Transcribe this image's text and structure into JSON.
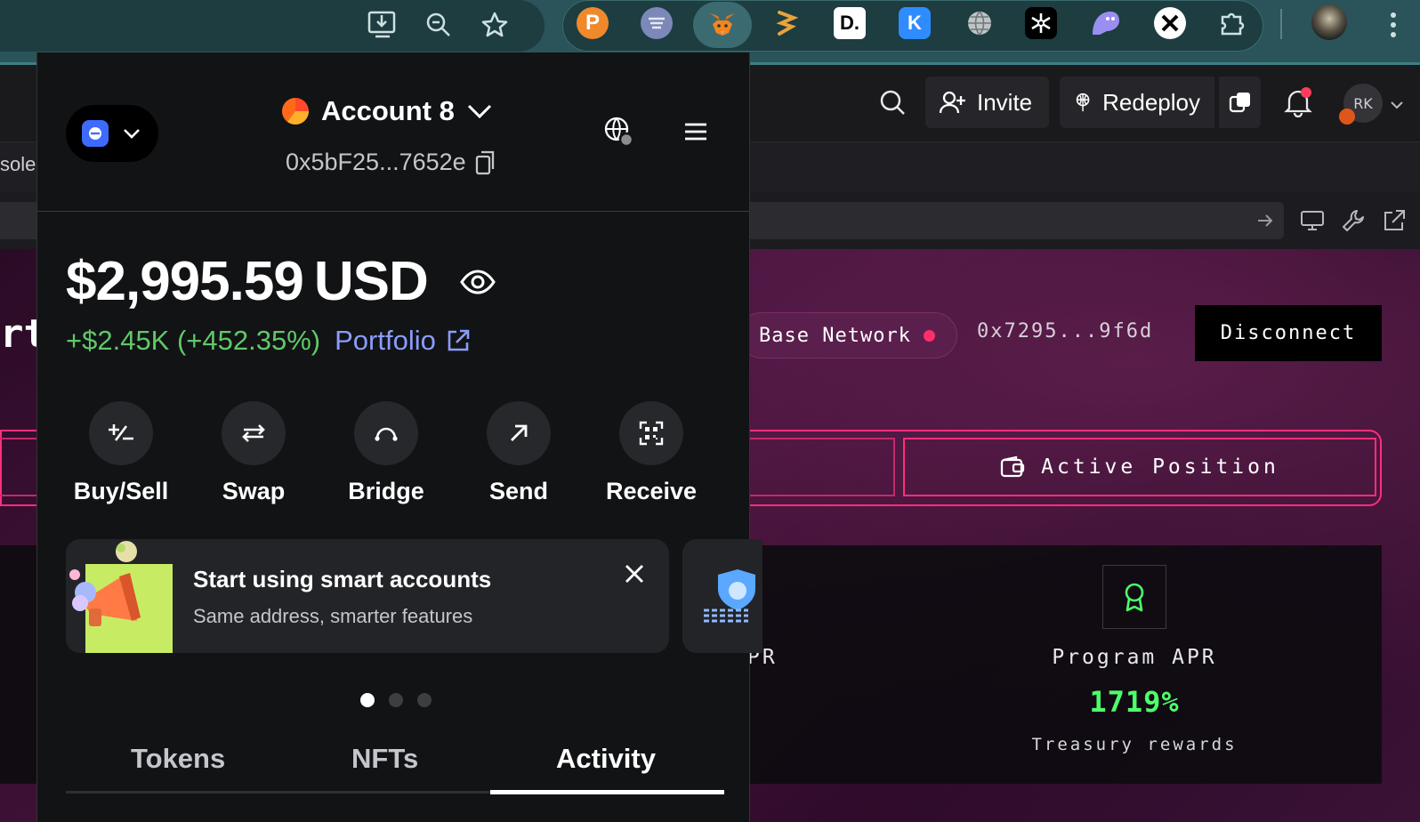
{
  "browser": {
    "toolbar_icons": [
      "install-app-icon",
      "zoom-icon",
      "bookmark-star-icon"
    ],
    "extensions": [
      "pocket-ext-icon",
      "shield-ext-icon",
      "metamask-ext-icon",
      "sushi-ext-icon",
      "d-ext-icon",
      "k-ext-icon",
      "globe-ext-icon",
      "snowflake-ext-icon",
      "ghost-ext-icon",
      "x-ext-icon",
      "puzzle-extensions-icon"
    ],
    "ext_letters": {
      "d": "D.",
      "k": "K"
    }
  },
  "app": {
    "invite_label": "Invite",
    "redeploy_label": "Redeploy",
    "avatar_initials": "RK",
    "console_partial": "sole",
    "title_partial": "rt",
    "network_label": "Base Network",
    "wallet_address": "0x7295...9f6d",
    "disconnect_label": "Disconnect",
    "active_position_label": "Active Position",
    "apr_partial": "PR",
    "program_apr_label": "Program APR",
    "program_apr_value": "1719%",
    "treasury_label": "Treasury rewards"
  },
  "wallet": {
    "account_name": "Account 8",
    "account_address": "0x5bF25...7652e",
    "balance": "$2,995.59",
    "currency": "USD",
    "change_value": "+$2.45K (+452.35%)",
    "portfolio_label": "Portfolio",
    "actions": [
      {
        "label": "Buy/Sell",
        "icon": "plus-minus-icon"
      },
      {
        "label": "Swap",
        "icon": "swap-arrows-icon"
      },
      {
        "label": "Bridge",
        "icon": "bridge-icon"
      },
      {
        "label": "Send",
        "icon": "arrow-up-right-icon"
      },
      {
        "label": "Receive",
        "icon": "qr-code-icon"
      }
    ],
    "promo_title": "Start using smart accounts",
    "promo_subtitle": "Same address, smarter features",
    "tabs": [
      {
        "label": "Tokens",
        "active": false
      },
      {
        "label": "NFTs",
        "active": false
      },
      {
        "label": "Activity",
        "active": true
      }
    ],
    "carousel_total": 3,
    "carousel_active": 1
  },
  "colors": {
    "positive": "#5fc96a",
    "link": "#8b9cff",
    "accent_pink": "#ff2f7a",
    "apr_green": "#4dff6a",
    "chrome_teal": "#2a5459"
  }
}
